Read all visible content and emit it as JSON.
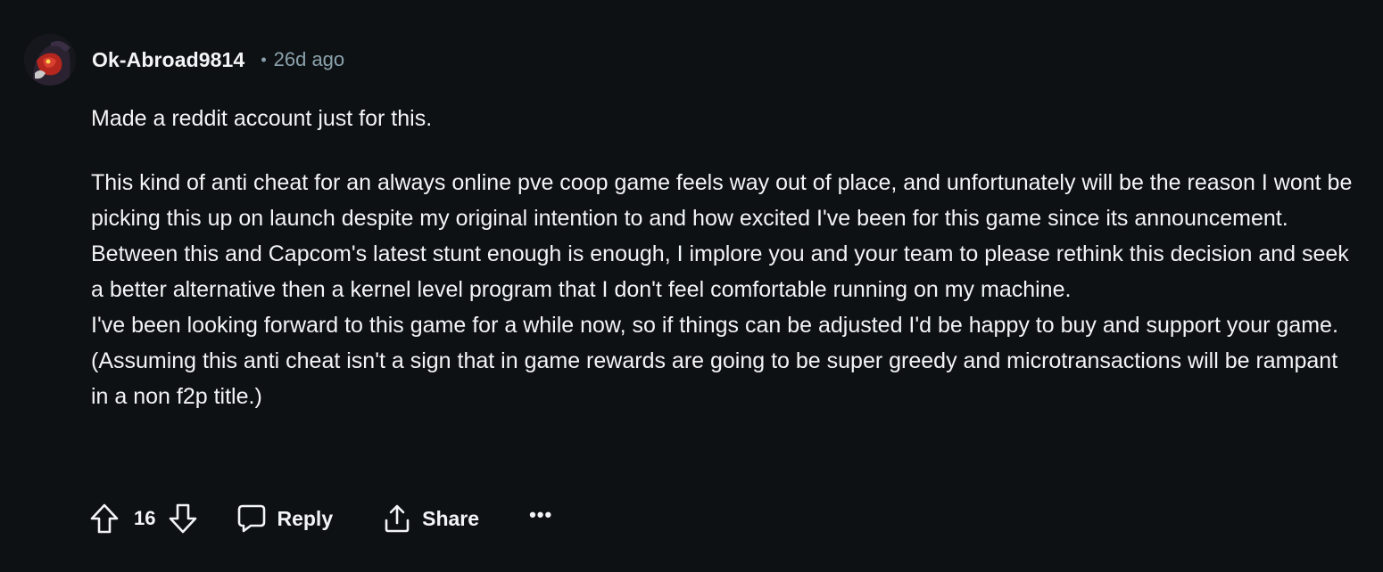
{
  "comment": {
    "author": "Ok-Abroad9814",
    "separator": "•",
    "timestamp": "26d ago",
    "avatar_icon": "avatar-icon",
    "paragraphs": [
      "Made a reddit account just for this.",
      "This kind of anti cheat for an always online pve coop game feels way out of place, and unfortunately will be the reason I wont be picking this up on launch despite my original intention to and how excited I've been for this game since its announcement.\nBetween this and Capcom's latest stunt enough is enough, I implore you and your team to please rethink this decision and seek a better alternative then a kernel level program that I don't feel comfortable running on my machine.\nI've been looking forward to this game for a while now, so if things can be adjusted I'd be happy to buy and support your game. (Assuming this anti cheat isn't a sign that in game rewards are going to be super greedy and microtransactions will be rampant in a non f2p title.)"
    ]
  },
  "actions": {
    "score": "16",
    "upvote_icon": "arrow-up-icon",
    "downvote_icon": "arrow-down-icon",
    "reply_icon": "comment-bubble-icon",
    "reply_label": "Reply",
    "share_icon": "share-icon",
    "share_label": "Share",
    "more_label": "•••"
  },
  "colors": {
    "background": "#0e1113",
    "text": "#f2f4f5",
    "muted": "#8ba2ad"
  }
}
